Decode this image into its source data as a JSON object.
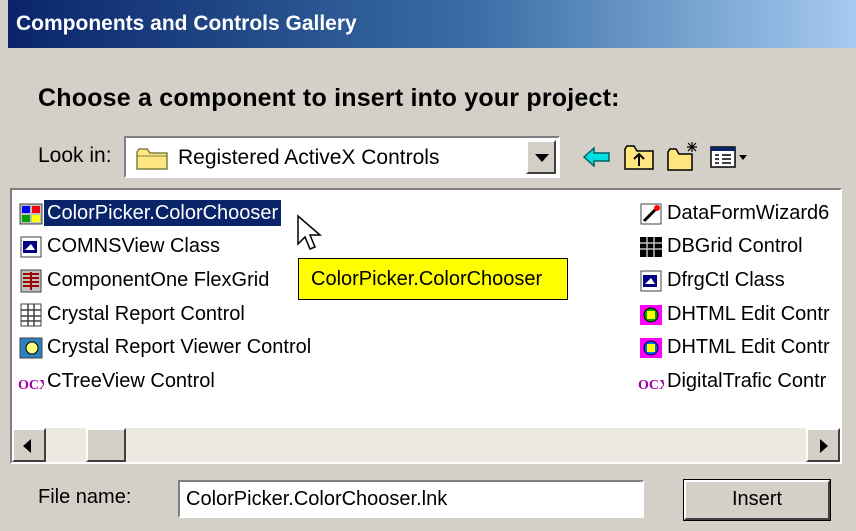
{
  "window": {
    "title": "Components and Controls Gallery"
  },
  "heading": "Choose a component to insert into your project:",
  "look_in": {
    "label": "Look in:",
    "value": "Registered ActiveX Controls"
  },
  "toolbar": [
    "back-arrow-icon",
    "up-folder-icon",
    "new-folder-icon",
    "view-menu-icon"
  ],
  "list": {
    "left_column": [
      {
        "label": "ColorPicker.ColorChooser",
        "icon": "control-icon",
        "selected": true
      },
      {
        "label": "COMNSView Class",
        "icon": "class-icon"
      },
      {
        "label": "ComponentOne FlexGrid",
        "icon": "grid-icon"
      },
      {
        "label": "Crystal Report Control",
        "icon": "report-icon"
      },
      {
        "label": "Crystal Report Viewer Control",
        "icon": "viewer-icon"
      },
      {
        "label": "CTreeView Control",
        "icon": "ocx-icon"
      }
    ],
    "right_column": [
      {
        "label": "DataFormWizard6",
        "icon": "wizard-icon"
      },
      {
        "label": "DBGrid  Control",
        "icon": "grid-icon"
      },
      {
        "label": "DfrgCtl Class",
        "icon": "class-icon"
      },
      {
        "label": "DHTML Edit Contr",
        "icon": "dhtml-icon"
      },
      {
        "label": "DHTML Edit Contr",
        "icon": "dhtml-icon"
      },
      {
        "label": "DigitalTrafic Contr",
        "icon": "ocx-icon"
      }
    ]
  },
  "tooltip": "ColorPicker.ColorChooser",
  "file_name": {
    "label": "File name:",
    "value": "ColorPicker.ColorChooser.lnk"
  },
  "insert_button": "Insert",
  "colors": {
    "title_bar": "#0a246a",
    "selection": "#0a246a",
    "tooltip": "#ffff00",
    "dialog": "#d4d0c8"
  }
}
